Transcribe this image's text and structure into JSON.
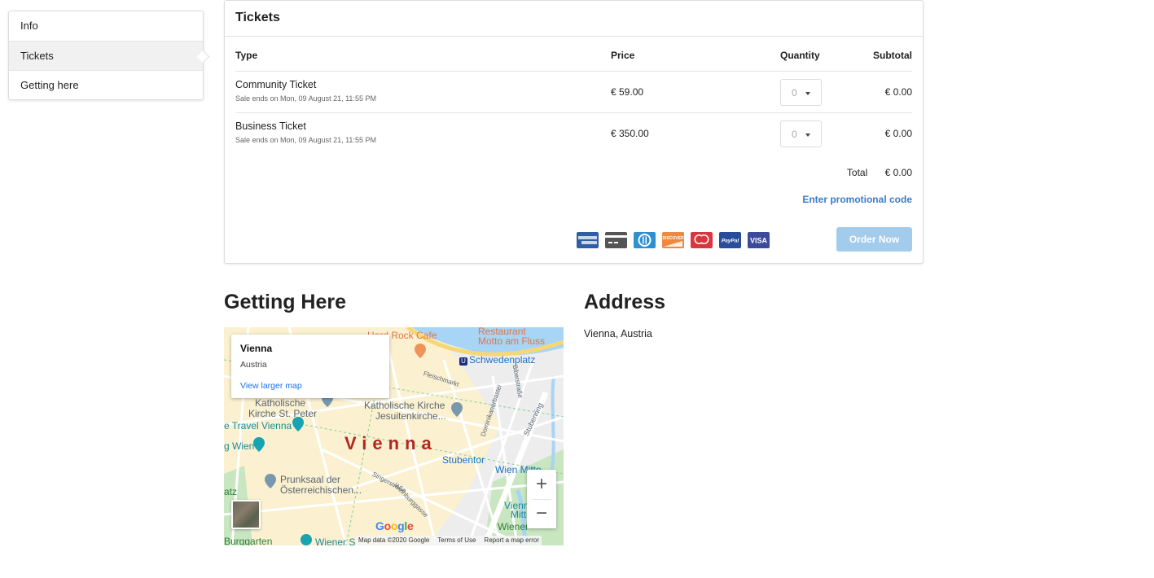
{
  "sidenav": {
    "items": [
      {
        "label": "Info",
        "active": false
      },
      {
        "label": "Tickets",
        "active": true
      },
      {
        "label": "Getting here",
        "active": false
      }
    ]
  },
  "tickets": {
    "title": "Tickets",
    "columns": {
      "type": "Type",
      "price": "Price",
      "quantity": "Quantity",
      "subtotal": "Subtotal"
    },
    "rows": [
      {
        "name": "Community Ticket",
        "sale_ends": "Sale ends on Mon, 09 August 21, 11:55 PM",
        "price": "€ 59.00",
        "quantity": "0",
        "subtotal": "€ 0.00"
      },
      {
        "name": "Business Ticket",
        "sale_ends": "Sale ends on Mon, 09 August 21, 11:55 PM",
        "price": "€ 350.00",
        "quantity": "0",
        "subtotal": "€ 0.00"
      }
    ],
    "total_label": "Total",
    "total_value": "€ 0.00",
    "promo_link": "Enter promotional code",
    "payment_methods": [
      {
        "icon": "amex-icon",
        "text": "AMERICAN EXPRESS",
        "color": "#2f5ea8"
      },
      {
        "icon": "credit-card-icon",
        "text": "",
        "color": "#555555"
      },
      {
        "icon": "diners-club-icon",
        "text": "",
        "color": "#2f8fcf"
      },
      {
        "icon": "discover-icon",
        "text": "DISCOVER",
        "color": "#f0883e"
      },
      {
        "icon": "mastercard-icon",
        "text": "",
        "color": "#d9363e"
      },
      {
        "icon": "paypal-icon",
        "text": "PayPal",
        "color": "#2a4c9c"
      },
      {
        "icon": "visa-icon",
        "text": "VISA",
        "color": "#3b4a9a"
      }
    ],
    "order_button": "Order Now",
    "order_button_color": "#a3cbec",
    "accent_color": "#3a7bc8"
  },
  "getting_here": {
    "title": "Getting Here",
    "map": {
      "info_title": "Vienna",
      "info_subtitle": "Austria",
      "info_link": "View larger map",
      "city_label": "Vienna",
      "labels": {
        "hard_rock": "Hard Rock Cafe",
        "restaurant": "Restaurant",
        "motto": "Motto am Fluss",
        "schwedenplatz": "Schwedenplatz",
        "fleischmarkt": "Fleischmarkt",
        "kirche_peter_1": "Katholische",
        "kirche_peter_2": "Kirche St. Peter",
        "kirche_jesuiten_1": "Katholische Kirche",
        "kirche_jesuiten_2": "Jesuitenkirche...",
        "travel_vienna": "e Travel Vienna",
        "wien": "g Wien",
        "stubentor": "Stubentor",
        "wien_mitte": "Wien Mitte",
        "prunksaal_1": "Prunksaal der",
        "prunksaal_2": "Österreichischen...",
        "atz": "atz",
        "burggarten": "Burggarten",
        "wiener_s": "Wiener S",
        "wiener_stadtpark": "Wiener",
        "vienna_mitte_1": "Vienna",
        "vienna_mitte_2": "Mitte",
        "singerstrasse": "Singerstraße",
        "weihburggasse": "Weihburggasse",
        "dominikanerbastei": "Dominikanerbastei",
        "biberstrasse": "Biberstraße",
        "stubenring": "Stubenring"
      },
      "zoom_in": "+",
      "zoom_out": "−",
      "google_logo": "Google",
      "attribution": "Map data ©2020 Google",
      "terms": "Terms of Use",
      "report": "Report a map error"
    }
  },
  "address": {
    "title": "Address",
    "text": "Vienna, Austria"
  }
}
